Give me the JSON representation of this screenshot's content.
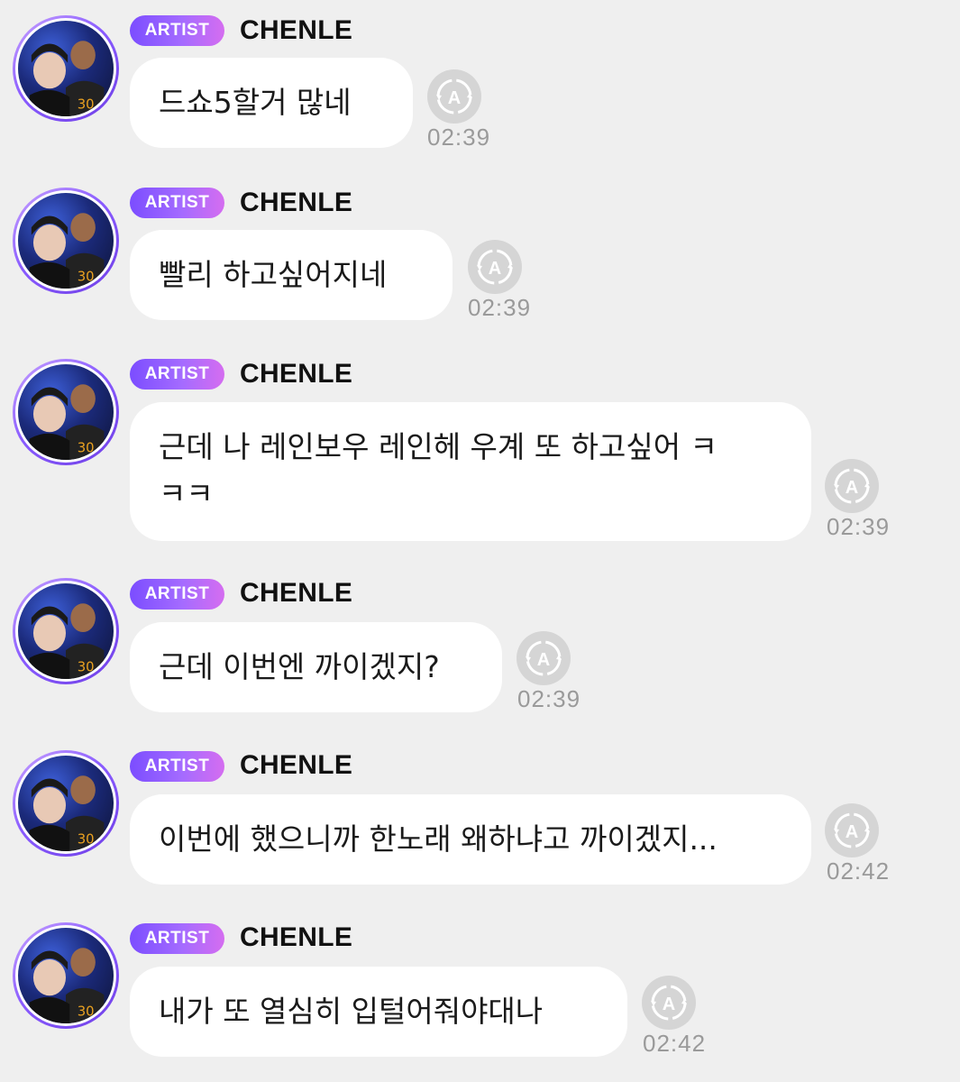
{
  "messages": [
    {
      "badge": "ARTIST",
      "sender": "CHENLE",
      "text": "드쇼5할거 많네",
      "time": "02:39",
      "icon": "replay-icon"
    },
    {
      "badge": "ARTIST",
      "sender": "CHENLE",
      "text": "빨리 하고싶어지네",
      "time": "02:39",
      "icon": "replay-icon"
    },
    {
      "badge": "ARTIST",
      "sender": "CHENLE",
      "text": "근데 나 레인보우 레인헤 우계 또 하고싶어 ㅋ\nㅋㅋ",
      "time": "02:39",
      "icon": "replay-icon"
    },
    {
      "badge": "ARTIST",
      "sender": "CHENLE",
      "text": "근데 이번엔 까이겠지?",
      "time": "02:39",
      "icon": "replay-icon"
    },
    {
      "badge": "ARTIST",
      "sender": "CHENLE",
      "text": "이번에 했으니까 한노래 왜하냐고 까이겠지...",
      "time": "02:42",
      "icon": "replay-icon"
    },
    {
      "badge": "ARTIST",
      "sender": "CHENLE",
      "text": "내가 또 열심히 입털어줘야대나",
      "time": "02:42",
      "icon": "replay-icon"
    }
  ],
  "colors": {
    "background": "#efefef",
    "bubble": "#ffffff",
    "badge_start": "#7b4dff",
    "badge_end": "#d56df0",
    "time": "#9a9a9a",
    "icon_bg": "#d5d5d5"
  }
}
